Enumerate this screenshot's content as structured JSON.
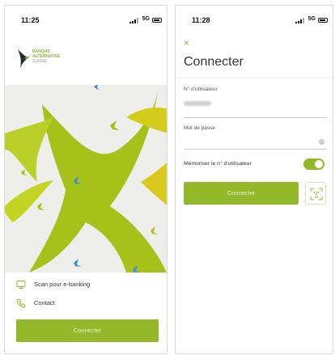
{
  "left_screen": {
    "status_bar": {
      "time": "11:25",
      "network": "5G"
    },
    "logo": {
      "line1": "BANQUE",
      "line2": "ALTERNATIVE",
      "line3": "SUISSE"
    },
    "menu": [
      {
        "label": "Scan pour e-banking",
        "icon": "monitor-icon"
      },
      {
        "label": "Contact",
        "icon": "phone-icon"
      }
    ],
    "connect_button": "Connecter"
  },
  "right_screen": {
    "status_bar": {
      "time": "11:28",
      "network": "5G"
    },
    "close_icon": "×",
    "title": "Connecter",
    "username": {
      "label": "N° d'utilisateur",
      "value_obscured": true
    },
    "password": {
      "label": "Mot de passe",
      "value": ""
    },
    "remember": {
      "label": "Mémoriser le n° d'utilisateur",
      "enabled": true
    },
    "connect_button": "Connecter",
    "biometric_icon": "face-id-icon"
  },
  "colors": {
    "accent": "#93b92b",
    "logo_green": "#8cb43a",
    "bird_blue": "#3d8fd1"
  }
}
